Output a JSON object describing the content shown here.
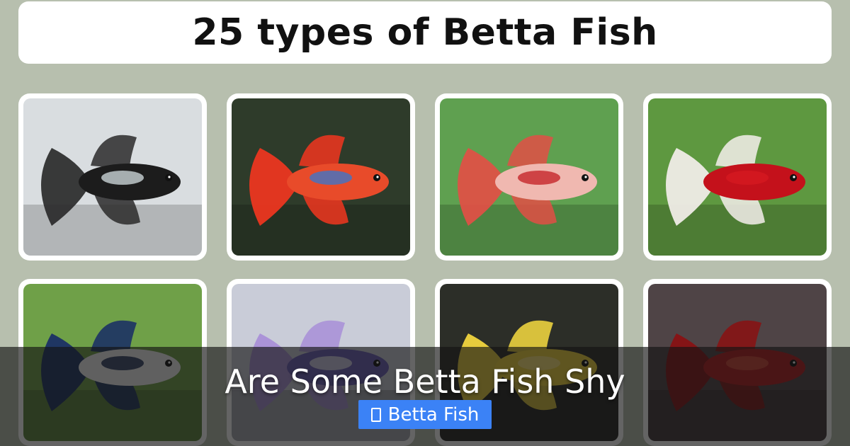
{
  "header": {
    "title": "25 types of Betta Fish"
  },
  "gallery": {
    "items": [
      {
        "name": "black-samurai-betta",
        "bg": "#d9dde0",
        "body": "#1c1c1c",
        "fin": "#2a2a2a",
        "accent": "#c9d3d6"
      },
      {
        "name": "koi-galaxy-betta",
        "bg": "#2e3b2a",
        "body": "#e84b2a",
        "fin": "#f1361f",
        "accent": "#3f74c7"
      },
      {
        "name": "candy-koi-betta",
        "bg": "#5fa050",
        "body": "#f0b8b0",
        "fin": "#e24f45",
        "accent": "#c6262a"
      },
      {
        "name": "red-dragon-halfmoon-betta",
        "bg": "#5e9840",
        "body": "#c4111b",
        "fin": "#f4efec",
        "accent": "#d61920"
      },
      {
        "name": "blue-marble-betta",
        "bg": "#6fa048",
        "body": "#f2f2f4",
        "fin": "#182c66",
        "accent": "#0f1f4a"
      },
      {
        "name": "lavender-halfmoon-betta",
        "bg": "#c9ccd8",
        "body": "#6b5fb8",
        "fin": "#a88ed8",
        "accent": "#e6e6f2"
      },
      {
        "name": "yellow-halfmoon-betta",
        "bg": "#2c2e28",
        "body": "#f0d23a",
        "fin": "#f7da3f",
        "accent": "#ffe987"
      },
      {
        "name": "red-veiltail-betta",
        "bg": "#4f4446",
        "body": "#b41a1c",
        "fin": "#8a1012",
        "accent": "#d84a3a"
      }
    ]
  },
  "banner": {
    "title": "Are Some Betta Fish Shy",
    "category": {
      "label": "Betta Fish",
      "icon": "folder-icon"
    }
  }
}
